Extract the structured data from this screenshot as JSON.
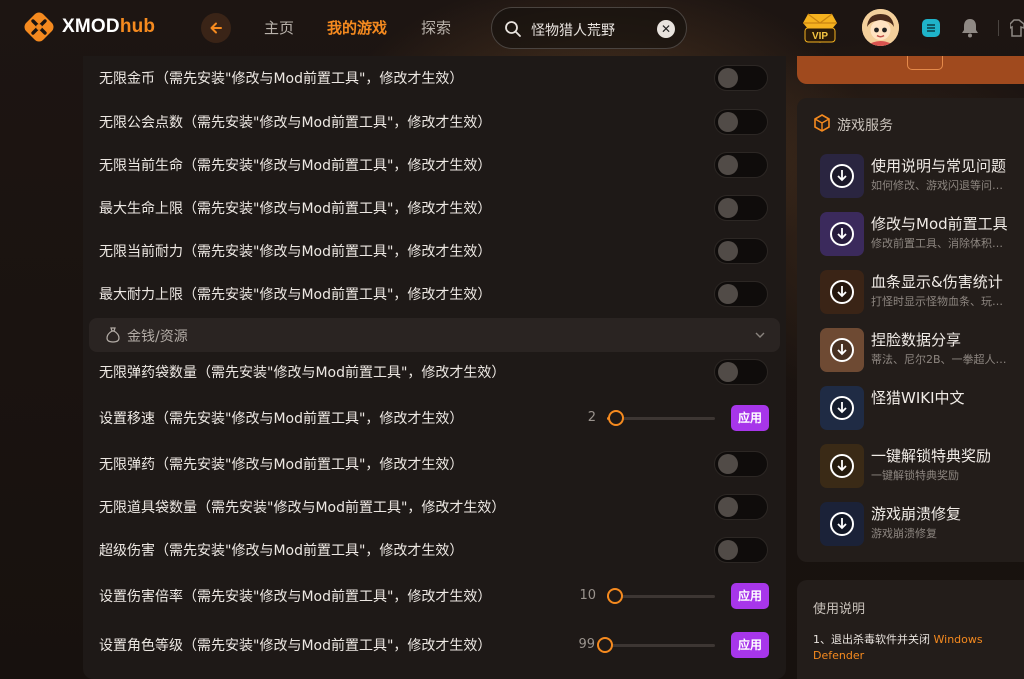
{
  "brand": {
    "name_part1": "XMOD",
    "name_part2": "hub"
  },
  "nav": {
    "items": [
      {
        "label": "主页",
        "active": false
      },
      {
        "label": "我的游戏",
        "active": true
      },
      {
        "label": "探索",
        "active": false
      }
    ]
  },
  "search": {
    "value": "怪物猎人荒野",
    "clear_glyph": "✕"
  },
  "vip": {
    "label": "VIP"
  },
  "colors": {
    "accent": "#f58a1f",
    "apply": "#a736ea",
    "panel": "#1e1917"
  },
  "cheats_top": [
    {
      "label": "无限金币（需先安装\"修改与Mod前置工具\"，修改才生效）",
      "control": "toggle",
      "on": false
    },
    {
      "label": "无限公会点数（需先安装\"修改与Mod前置工具\"，修改才生效）",
      "control": "toggle",
      "on": false
    },
    {
      "label": "无限当前生命（需先安装\"修改与Mod前置工具\"，修改才生效）",
      "control": "toggle",
      "on": false
    },
    {
      "label": "最大生命上限（需先安装\"修改与Mod前置工具\"，修改才生效）",
      "control": "toggle",
      "on": false
    },
    {
      "label": "无限当前耐力（需先安装\"修改与Mod前置工具\"，修改才生效）",
      "control": "toggle",
      "on": false
    },
    {
      "label": "最大耐力上限（需先安装\"修改与Mod前置工具\"，修改才生效）",
      "control": "toggle",
      "on": false
    }
  ],
  "section": {
    "label": "金钱/资源",
    "icon": "money-bag-icon"
  },
  "cheats_bottom": [
    {
      "label": "无限弹药袋数量（需先安装\"修改与Mod前置工具\"，修改才生效）",
      "control": "toggle",
      "on": false
    },
    {
      "label": "设置移速（需先安装\"修改与Mod前置工具\"，修改才生效）",
      "control": "slider",
      "value": "2",
      "apply": "应用",
      "fill_fraction": 0.03
    },
    {
      "label": "无限弹药（需先安装\"修改与Mod前置工具\"，修改才生效）",
      "control": "toggle",
      "on": false
    },
    {
      "label": "无限道具袋数量（需先安装\"修改与Mod前置工具\"，修改才生效）",
      "control": "toggle",
      "on": false
    },
    {
      "label": "超级伤害（需先安装\"修改与Mod前置工具\"，修改才生效）",
      "control": "toggle",
      "on": false
    },
    {
      "label": "设置伤害倍率（需先安装\"修改与Mod前置工具\"，修改才生效）",
      "control": "slider",
      "value": "10",
      "apply": "应用",
      "fill_fraction": 0.02
    },
    {
      "label": "设置角色等级（需先安装\"修改与Mod前置工具\"，修改才生效）",
      "control": "slider",
      "value": "99",
      "apply": "应用",
      "fill_fraction": 0.0
    }
  ],
  "services": {
    "title": "游戏服务",
    "items": [
      {
        "title": "使用说明与常见问题",
        "subtitle": "如何修改、游戏闪退等问…",
        "thumb_color": "#2a2540"
      },
      {
        "title": "修改与Mod前置工具",
        "subtitle": "修改前置工具、消除体积…",
        "thumb_color": "#3b2a5c"
      },
      {
        "title": "血条显示&伤害统计",
        "subtitle": "打怪时显示怪物血条、玩…",
        "thumb_color": "#3a2416"
      },
      {
        "title": "捏脸数据分享",
        "subtitle": "蒂法、尼尔2B、一拳超人…",
        "thumb_color": "#6e4a33"
      },
      {
        "title": "怪猎WIKI中文",
        "subtitle": "",
        "thumb_color": "#1f2b44"
      },
      {
        "title": "一键解锁特典奖励",
        "subtitle": "一键解锁特典奖励",
        "thumb_color": "#3a2a16"
      },
      {
        "title": "游戏崩溃修复",
        "subtitle": "游戏崩溃修复",
        "thumb_color": "#1b2238"
      }
    ]
  },
  "guide": {
    "title": "使用说明",
    "line1_prefix": "1、退出杀毒软件并关闭",
    "line1_highlight": "Windows Defender"
  }
}
